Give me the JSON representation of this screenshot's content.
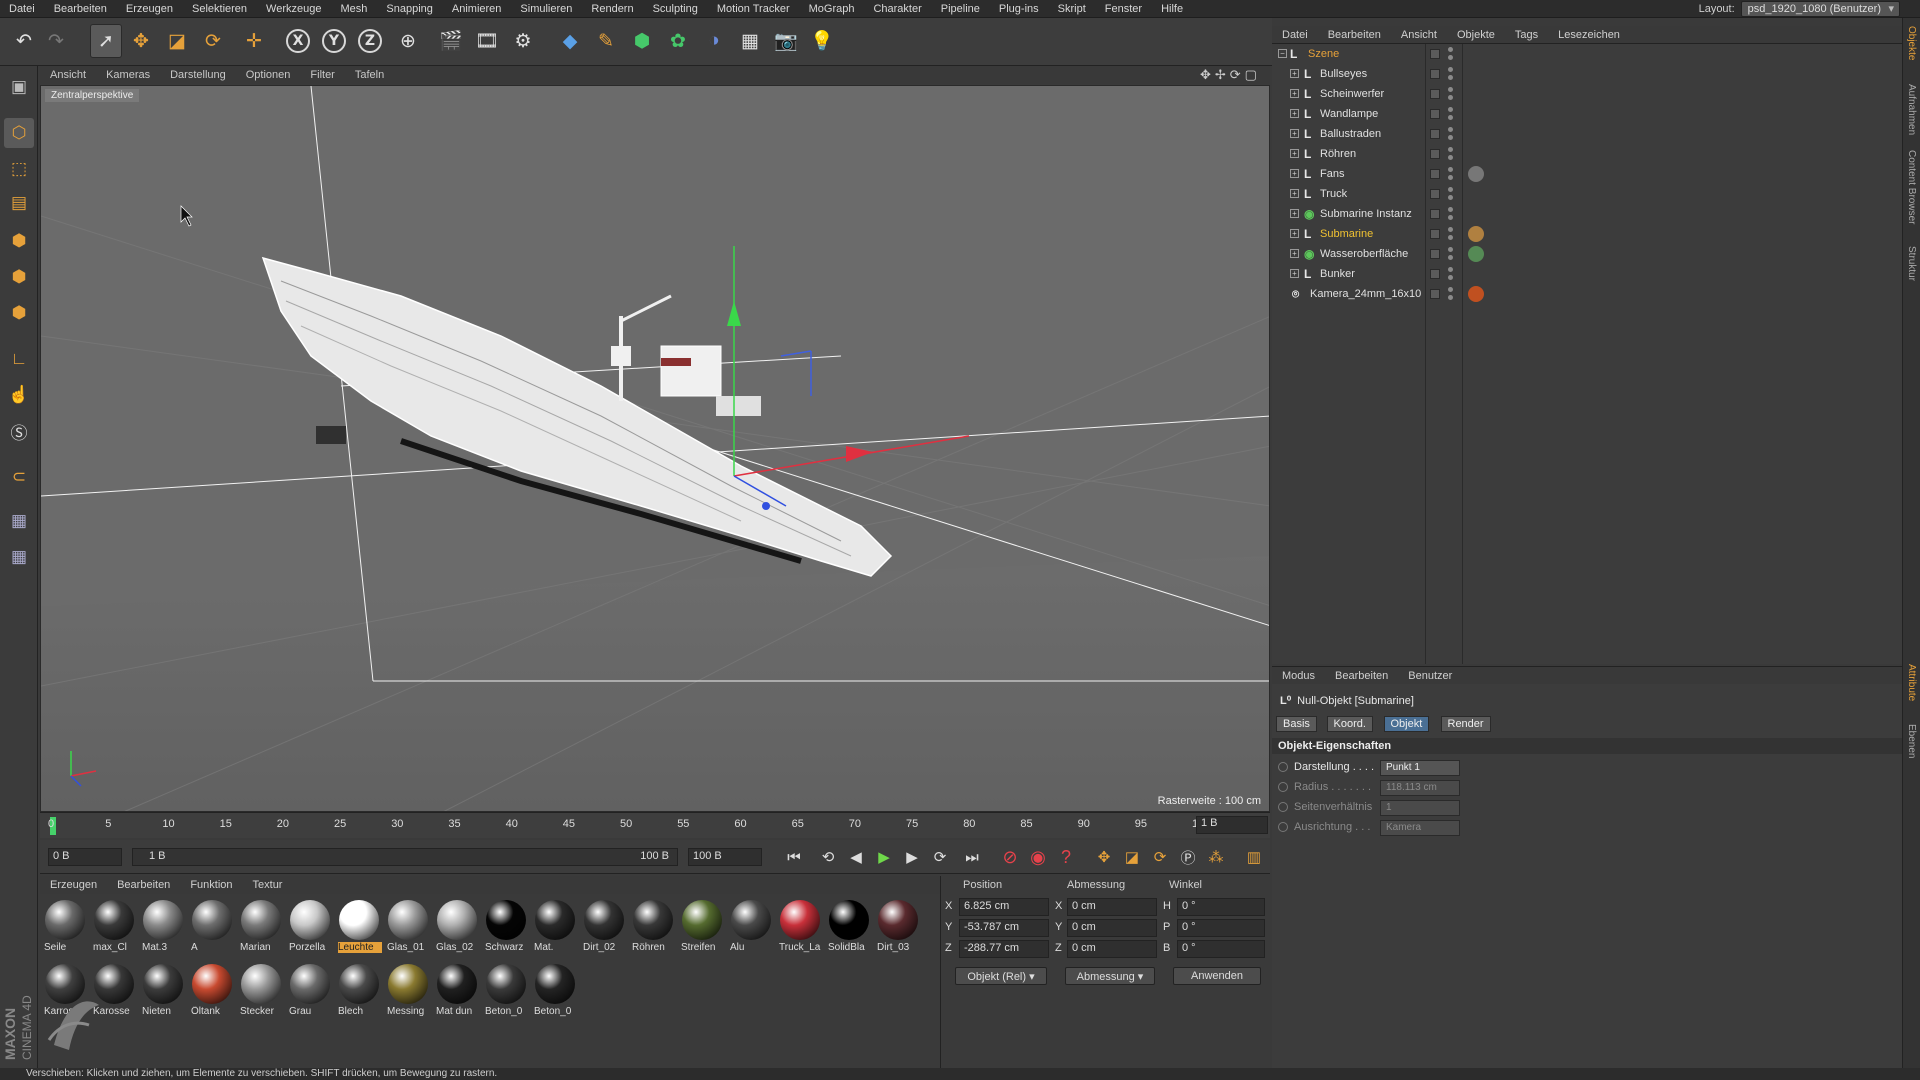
{
  "menu": [
    "Datei",
    "Bearbeiten",
    "Erzeugen",
    "Selektieren",
    "Werkzeuge",
    "Mesh",
    "Snapping",
    "Animieren",
    "Simulieren",
    "Rendern",
    "Sculpting",
    "Motion Tracker",
    "MoGraph",
    "Charakter",
    "Pipeline",
    "Plug-ins",
    "Skript",
    "Fenster",
    "Hilfe"
  ],
  "layout": {
    "label": "Layout:",
    "value": "psd_1920_1080 (Benutzer)"
  },
  "viewport": {
    "menu": [
      "Ansicht",
      "Kameras",
      "Darstellung",
      "Optionen",
      "Filter",
      "Tafeln"
    ],
    "camera_label": "Zentralperspektive",
    "grid_label": "Rasterweite : 100 cm"
  },
  "timeline": {
    "ticks": [
      "0",
      "5",
      "10",
      "15",
      "20",
      "25",
      "30",
      "35",
      "40",
      "45",
      "50",
      "55",
      "60",
      "65",
      "70",
      "75",
      "80",
      "85",
      "90",
      "95",
      "100"
    ],
    "current": "1 B"
  },
  "transport": {
    "start": "0 B",
    "range_start": "1 B",
    "range_end": "100 B",
    "end": "100 B"
  },
  "materials": {
    "menu": [
      "Erzeugen",
      "Bearbeiten",
      "Funktion",
      "Textur"
    ],
    "row1": [
      {
        "name": "Seile",
        "color": "#6a6a6a"
      },
      {
        "name": "max_Cl",
        "color": "#3a3a3a"
      },
      {
        "name": "Mat.3",
        "color": "#8a8a8a"
      },
      {
        "name": "A",
        "color": "#6e6e6e"
      },
      {
        "name": "Marian",
        "color": "#7a7a7a"
      },
      {
        "name": "Porzella",
        "color": "#c8c8c8"
      },
      {
        "name": "Leuchte",
        "color": "#ffffff"
      },
      {
        "name": "Glas_01",
        "color": "#9a9a9a"
      },
      {
        "name": "Glas_02",
        "color": "#b0b0b0"
      },
      {
        "name": "Schwarz",
        "color": "#050505"
      },
      {
        "name": "Mat.",
        "color": "#2a2a2a"
      },
      {
        "name": "Dirt_02",
        "color": "#333333"
      },
      {
        "name": "Röhren",
        "color": "#383838"
      },
      {
        "name": "Streifen",
        "color": "#556b2f"
      },
      {
        "name": "Alu",
        "color": "#4a4a4a"
      },
      {
        "name": "Truck_La",
        "color": "#c8303a"
      },
      {
        "name": "SolidBla",
        "color": "#000000"
      },
      {
        "name": "Dirt_03",
        "color": "#5a2a2e"
      }
    ],
    "row2": [
      {
        "name": "Karross",
        "color": "#404040"
      },
      {
        "name": "Karosse",
        "color": "#383838"
      },
      {
        "name": "Nieten",
        "color": "#3c3c3c"
      },
      {
        "name": "Öltank",
        "color": "#c84a30"
      },
      {
        "name": "Stecker",
        "color": "#9a9a9a"
      },
      {
        "name": "Grau",
        "color": "#6a6a6a"
      },
      {
        "name": "Blech",
        "color": "#4a4a4a"
      },
      {
        "name": "Messing",
        "color": "#8a7a30"
      },
      {
        "name": "Mat dun",
        "color": "#202020"
      },
      {
        "name": "Beton_0",
        "color": "#3a3a3a"
      },
      {
        "name": "Beton_0",
        "color": "#242424"
      }
    ],
    "selected": "Leuchte"
  },
  "coords": {
    "headers": [
      "Position",
      "Abmessung",
      "Winkel"
    ],
    "rows": [
      {
        "axis": "X",
        "pos": "6.825 cm",
        "size_axis": "X",
        "size": "0 cm",
        "rot_axis": "H",
        "rot": "0 °"
      },
      {
        "axis": "Y",
        "pos": "-53.787 cm",
        "size_axis": "Y",
        "size": "0 cm",
        "rot_axis": "P",
        "rot": "0 °"
      },
      {
        "axis": "Z",
        "pos": "-288.77 cm",
        "size_axis": "Z",
        "size": "0 cm",
        "rot_axis": "B",
        "rot": "0 °"
      }
    ],
    "mode": "Objekt (Rel)",
    "size_mode": "Abmessung",
    "apply": "Anwenden"
  },
  "objects": {
    "menu": [
      "Datei",
      "Bearbeiten",
      "Ansicht",
      "Objekte",
      "Tags",
      "Lesezeichen"
    ],
    "items": [
      {
        "name": "Szene",
        "root": true
      },
      {
        "name": "Bullseyes"
      },
      {
        "name": "Scheinwerfer"
      },
      {
        "name": "Wandlampe"
      },
      {
        "name": "Ballustraden"
      },
      {
        "name": "Röhren"
      },
      {
        "name": "Fans"
      },
      {
        "name": "Truck"
      },
      {
        "name": "Submarine Instanz"
      },
      {
        "name": "Submarine",
        "selected": true
      },
      {
        "name": "Wasseroberfläche"
      },
      {
        "name": "Bunker"
      },
      {
        "name": "Kamera_24mm_16x10"
      }
    ]
  },
  "attributes": {
    "menu": [
      "Modus",
      "Bearbeiten",
      "Benutzer"
    ],
    "title": "Null-Objekt [Submarine]",
    "tabs": [
      "Basis",
      "Koord.",
      "Objekt",
      "Render"
    ],
    "active_tab": "Objekt",
    "section": "Objekt-Eigenschaften",
    "props": [
      {
        "label": "Darstellung . . . .",
        "value": "Punkt 1",
        "enabled": true
      },
      {
        "label": "Radius . . . . . . .",
        "value": "118.113 cm",
        "enabled": false
      },
      {
        "label": "Seitenverhältnis",
        "value": "1",
        "enabled": false
      },
      {
        "label": "Ausrichtung . . .",
        "value": "Kamera",
        "enabled": false
      }
    ]
  },
  "right_tabs": [
    "Objekte",
    "Aufnahmen",
    "Content Browser",
    "Struktur",
    "Attribute",
    "Ebenen"
  ],
  "status": "Verschieben: Klicken und ziehen, um Elemente zu verschieben. SHIFT drücken, um Bewegung zu rastern.",
  "logo": {
    "line1": "MAXON",
    "line2": "CINEMA 4D"
  },
  "accent": "#e6a13a"
}
